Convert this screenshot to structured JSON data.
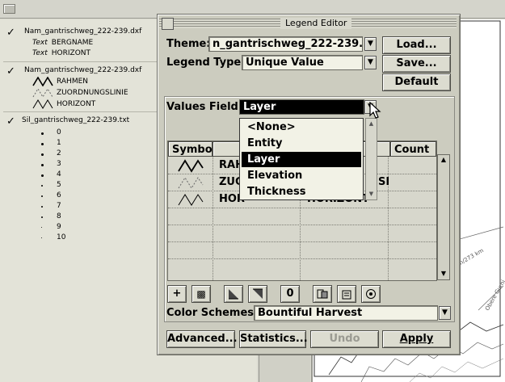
{
  "toc": {
    "themes": [
      {
        "name": "Nam_gantrischweg_222-239.dxf",
        "rows": [
          {
            "type": "Text",
            "value": "BERGNAME"
          },
          {
            "type": "Text",
            "value": "HORIZONT"
          }
        ]
      },
      {
        "name": "Nam_gantrischweg_222-239.dxf",
        "lines": [
          "RAHMEN",
          "ZUORDNUNGSLINIE",
          "HORIZONT"
        ]
      },
      {
        "name": "Sil_gantrischweg_222-239.txt",
        "points": [
          "0",
          "1",
          "2",
          "3",
          "4",
          "5",
          "6",
          "7",
          "8",
          "9",
          "10"
        ]
      }
    ]
  },
  "map": {
    "labels": [
      "m/273 km",
      "Obere Gurni"
    ]
  },
  "dialog": {
    "title": "Legend Editor",
    "theme_label": "Theme:",
    "theme_value": "n_gantrischweg_222-239.dxf",
    "legend_type_label": "Legend Type:",
    "legend_type_value": "Unique Value",
    "values_field_label": "Values Field:",
    "values_field_value": "Layer",
    "buttons": {
      "load": "Load...",
      "save": "Save...",
      "default": "Default",
      "advanced": "Advanced...",
      "statistics": "Statistics...",
      "undo": "Undo",
      "apply": "Apply"
    },
    "table": {
      "headers": [
        "Symbol",
        "",
        "Count"
      ],
      "rows": [
        {
          "label": "RAH",
          "value": ""
        },
        {
          "label": "ZUG",
          "value": "SI"
        },
        {
          "label": "HOR",
          "value": "HORIZONT"
        }
      ]
    },
    "toolbar": {
      "add": "+",
      "delete": "▩",
      "zero": "0"
    },
    "color_schemes_label": "Color Schemes:",
    "color_schemes_value": "Bountiful Harvest",
    "dropdown": {
      "options": [
        "<None>",
        "Entity",
        "Layer",
        "Elevation",
        "Thickness"
      ],
      "selected": "Layer"
    }
  }
}
